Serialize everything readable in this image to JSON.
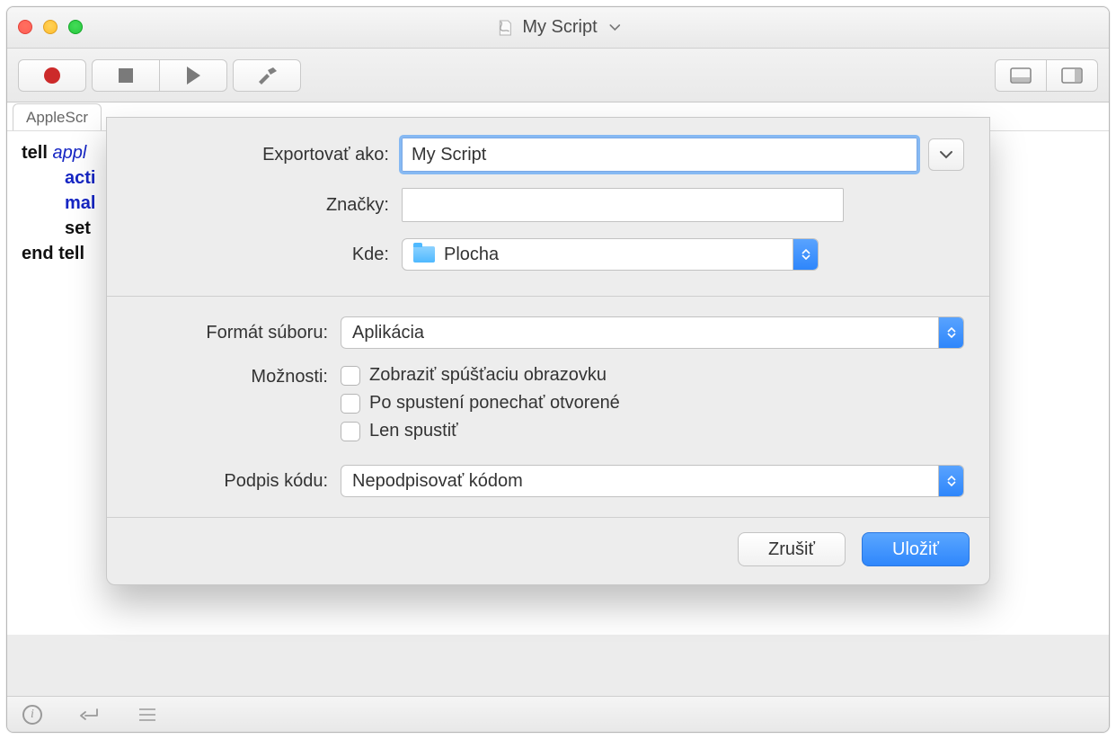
{
  "window": {
    "title": "My Script"
  },
  "toolbar": {
    "record": "record",
    "stop": "stop",
    "play": "play",
    "build": "build"
  },
  "tabs": [
    {
      "label": "AppleScr"
    }
  ],
  "editor": {
    "line1_kw": "tell",
    "line1_app": "appl",
    "line2_cmd": "acti",
    "line3_cmd": "mal",
    "line4_kw": "set",
    "line5_kw": "end tell"
  },
  "sheet": {
    "export_as_label": "Exportovať ako:",
    "export_as_value": "My Script",
    "tags_label": "Značky:",
    "where_label": "Kde:",
    "where_value": "Plocha",
    "format_label": "Formát súboru:",
    "format_value": "Aplikácia",
    "options_label": "Možnosti:",
    "option1": "Zobraziť spúšťaciu obrazovku",
    "option2": "Po spustení ponechať otvorené",
    "option3": "Len spustiť",
    "sign_label": "Podpis kódu:",
    "sign_value": "Nepodpisovať kódom",
    "cancel": "Zrušiť",
    "save": "Uložiť"
  }
}
